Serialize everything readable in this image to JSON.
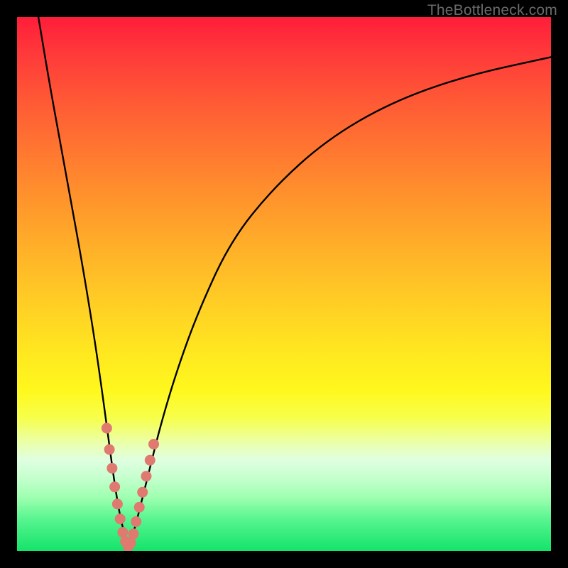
{
  "watermark": "TheBottleneck.com",
  "chart_data": {
    "type": "line",
    "title": "",
    "xlabel": "",
    "ylabel": "",
    "xlim": [
      0,
      100
    ],
    "ylim": [
      0,
      100
    ],
    "grid": false,
    "legend": false,
    "series": [
      {
        "name": "left-branch",
        "x": [
          4,
          6,
          8,
          10,
          12,
          14,
          15.5,
          17,
          18,
          19,
          20,
          20.8
        ],
        "y": [
          100,
          88,
          77,
          66,
          55,
          43,
          33,
          22,
          14.5,
          8,
          3.5,
          0.5
        ]
      },
      {
        "name": "right-branch",
        "x": [
          20.8,
          22,
          23.5,
          25,
          27,
          30,
          34,
          40,
          48,
          58,
          70,
          84,
          100
        ],
        "y": [
          0.5,
          4,
          10,
          16,
          24,
          34,
          45,
          58,
          68,
          77,
          84,
          89,
          92.5
        ]
      }
    ],
    "markers": {
      "name": "dense-points",
      "points": [
        {
          "x": 16.8,
          "y": 23
        },
        {
          "x": 17.3,
          "y": 19
        },
        {
          "x": 17.8,
          "y": 15.5
        },
        {
          "x": 18.3,
          "y": 12
        },
        {
          "x": 18.8,
          "y": 8.8
        },
        {
          "x": 19.3,
          "y": 6
        },
        {
          "x": 19.8,
          "y": 3.5
        },
        {
          "x": 20.3,
          "y": 1.8
        },
        {
          "x": 20.8,
          "y": 0.8
        },
        {
          "x": 21.3,
          "y": 1.5
        },
        {
          "x": 21.8,
          "y": 3.2
        },
        {
          "x": 22.3,
          "y": 5.5
        },
        {
          "x": 22.9,
          "y": 8.2
        },
        {
          "x": 23.5,
          "y": 11
        },
        {
          "x": 24.2,
          "y": 14
        },
        {
          "x": 24.9,
          "y": 17
        },
        {
          "x": 25.6,
          "y": 20
        }
      ]
    },
    "gradient_stops": [
      {
        "pos": 0,
        "color": "#ff1d3a"
      },
      {
        "pos": 70,
        "color": "#fff81e"
      },
      {
        "pos": 100,
        "color": "#14e36a"
      }
    ]
  }
}
